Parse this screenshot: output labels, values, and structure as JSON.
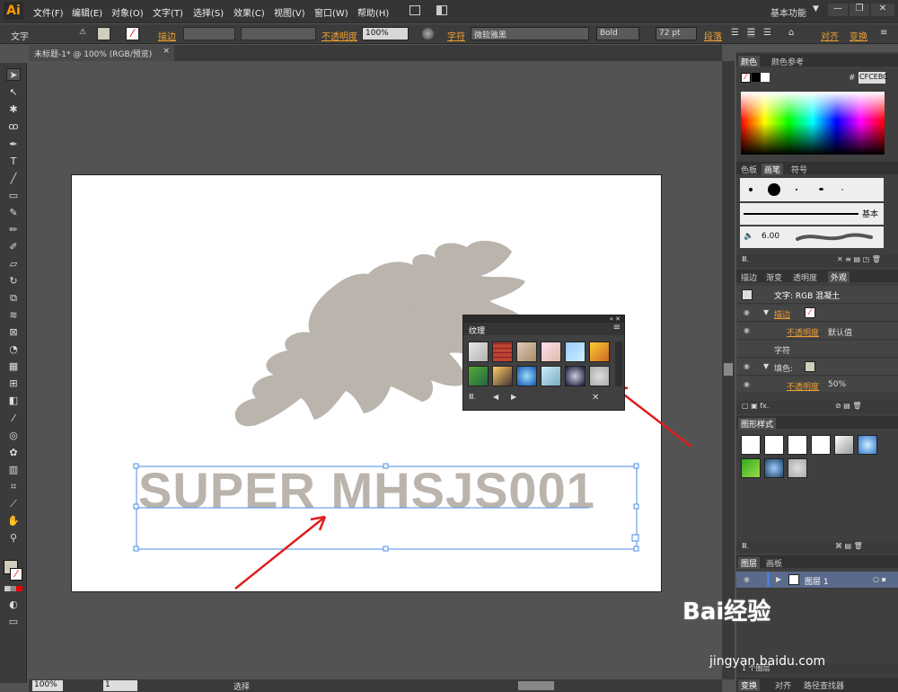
{
  "app": {
    "logo": "Ai"
  },
  "menu": [
    "文件(F)",
    "编辑(E)",
    "对象(O)",
    "文字(T)",
    "选择(S)",
    "效果(C)",
    "视图(V)",
    "窗口(W)",
    "帮助(H)"
  ],
  "workspace": "基本功能",
  "control": {
    "label": "文字",
    "stroke_label": "描边",
    "opacity_label": "不透明度",
    "opacity_value": "100%",
    "char_label": "字符",
    "font": "微软雅黑",
    "style": "Bold",
    "size": "72 pt",
    "para_label": "段落",
    "align_label": "对齐",
    "transform_label": "变换"
  },
  "document": {
    "tab": "未标题-1* @ 100% (RGB/预览)"
  },
  "artboard": {
    "text": "SUPER MHSJS001"
  },
  "status": {
    "zoom": "100%",
    "page": "1",
    "mode": "选择"
  },
  "texture_panel": {
    "title": "纹理"
  },
  "panels": {
    "color_tabs": [
      "颜色",
      "颜色参考"
    ],
    "hex_label": "#",
    "hex": "CFCEBC",
    "brush_tabs": [
      "色板",
      "画笔",
      "符号"
    ],
    "brush_basic": "基本",
    "brush_size": "6.00",
    "appearance_tabs": [
      "描边",
      "渐变",
      "透明度",
      "外观"
    ],
    "appearance_title": "文字: RGB 混凝土",
    "stroke_label": "描边",
    "opacity_label": "不透明度",
    "opacity_default": "默认值",
    "char_label": "字符",
    "fill_label": "填色:",
    "fill_opacity": "50%",
    "graphic_styles": "图形样式",
    "layers_tabs": [
      "图层",
      "画板"
    ],
    "layer1": "图层 1",
    "layer_count": "1 个图层",
    "bottom_tabs": [
      "变换",
      "对齐",
      "路径查找器"
    ]
  },
  "watermark": {
    "brand": "Bai经验",
    "url": "jingyan.baidu.com"
  },
  "colors": {
    "texture_gray": "#b8b2aa",
    "selection_blue": "#4a8ee8",
    "arrow_red": "#e01e1e",
    "accent_orange": "#f0a030"
  }
}
